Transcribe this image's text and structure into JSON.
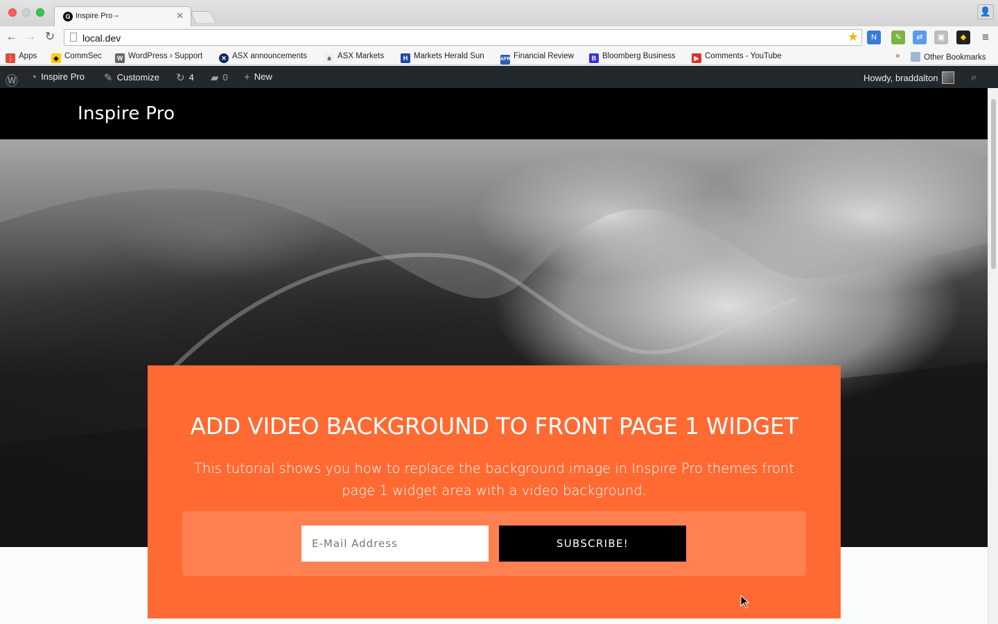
{
  "browser": {
    "tab_title": "Inspire Pro –",
    "tab_favicon": "G",
    "url": "local.dev",
    "colors": {
      "close": "#fc5f57",
      "maximize": "#34c84a"
    }
  },
  "bookmarks": [
    {
      "label": "Apps",
      "icon": "apps-grid-icon"
    },
    {
      "label": "CommSec",
      "icon": "commsec-icon"
    },
    {
      "label": "WordPress › Support",
      "icon": "wordpress-icon"
    },
    {
      "label": "ASX announcements",
      "icon": "asx-icon"
    },
    {
      "label": "ASX Markets",
      "icon": "the-age-icon"
    },
    {
      "label": "Markets Herald Sun",
      "icon": "herald-sun-icon"
    },
    {
      "label": "Financial Review",
      "icon": "afr-icon"
    },
    {
      "label": "Bloomberg Business",
      "icon": "bloomberg-icon"
    },
    {
      "label": "Comments - YouTube",
      "icon": "youtube-icon"
    },
    {
      "label": "Other Bookmarks",
      "icon": "folder-icon"
    }
  ],
  "bookmarks_overflow": "»",
  "admin_bar": {
    "site_name": "Inspire Pro",
    "customize": "Customize",
    "updates_count": "4",
    "comments_count": "0",
    "new_label": "New",
    "howdy": "Howdy, braddalton"
  },
  "site": {
    "title": "Inspire Pro",
    "widget_title": "ADD VIDEO BACKGROUND TO FRONT PAGE 1 WIDGET",
    "widget_text": "This tutorial shows you how to replace the background image in Inspire Pro themes front page 1 widget area with a video background.",
    "email_placeholder": "E-Mail Address",
    "subscribe_label": "SUBSCRIBE!",
    "accent_color": "#ff6a33"
  }
}
